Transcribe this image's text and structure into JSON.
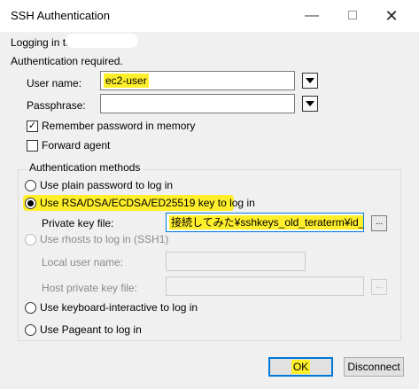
{
  "window": {
    "title": "SSH Authentication",
    "minimize_glyph": "—",
    "close_glyph": "✕"
  },
  "logging_in_label": "Logging in to",
  "auth_required": "Authentication required.",
  "username": {
    "label": "User name:",
    "value": "ec2-user"
  },
  "passphrase": {
    "label": "Passphrase:",
    "value": ""
  },
  "remember_password": {
    "label": "Remember password in memory",
    "checked": true,
    "glyph": "✓"
  },
  "forward_agent": {
    "label": "Forward agent",
    "checked": false
  },
  "auth_methods": {
    "legend": "Authentication methods",
    "plain_password": "Use plain password to log in",
    "rsa_key": "Use RSA/DSA/ECDSA/ED25519 key to log in",
    "private_key_label": "Private key file:",
    "private_key_value": "接続してみた¥sshkeys_old_teraterm¥id_rsa",
    "browse_glyph": "...",
    "rhosts": "Use rhosts to log in (SSH1)",
    "local_user_label": "Local user name:",
    "host_key_label": "Host private key file:",
    "keyboard_interactive": "Use keyboard-interactive to log in",
    "pageant": "Use Pageant to log in"
  },
  "buttons": {
    "ok": "OK",
    "disconnect": "Disconnect"
  },
  "colors": {
    "highlight": "#ffef2a",
    "focus_border": "#0078d7"
  }
}
